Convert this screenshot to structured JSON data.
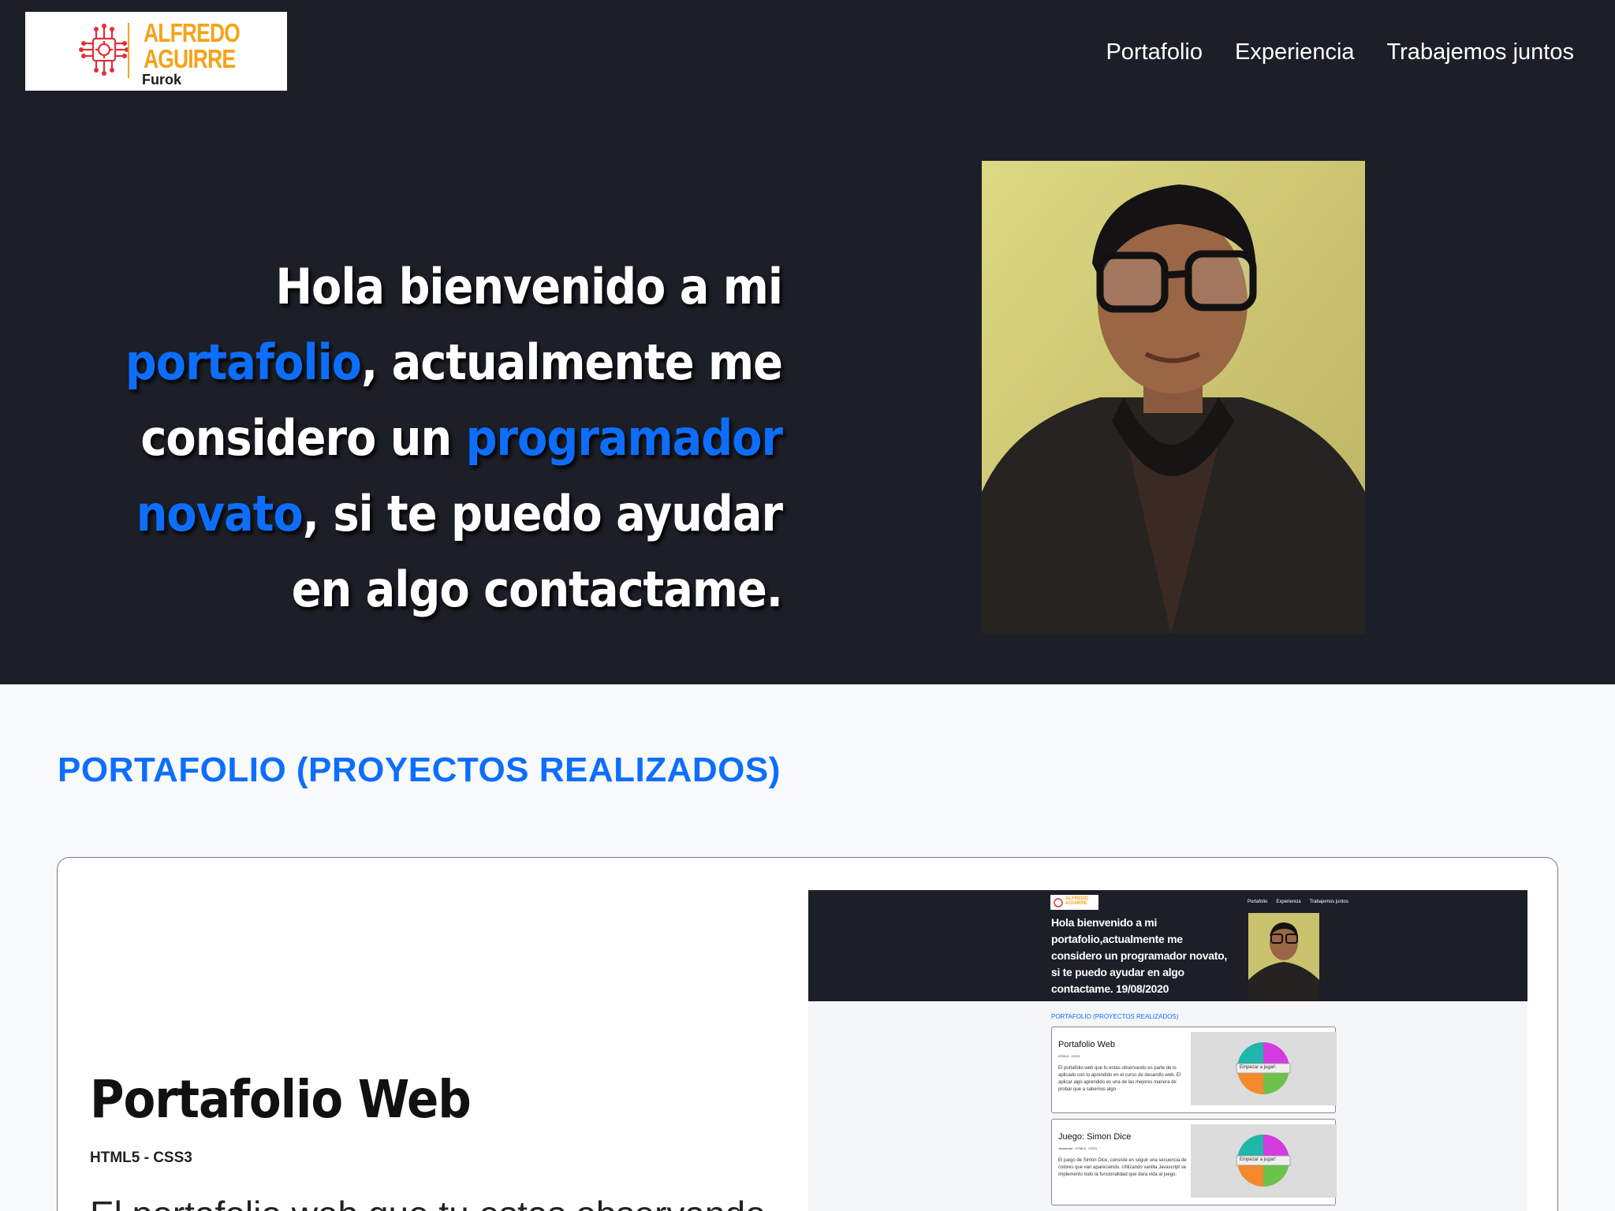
{
  "colors": {
    "header_bg": "#1c1f27",
    "accent": "#0d6efd",
    "logo_orange": "#f4a31a",
    "logo_red": "#e0303a",
    "page_bg": "#f8f9fb"
  },
  "logo": {
    "name_line1": "ALFREDO",
    "name_line2": "AGUIRRE",
    "sub": "Furok",
    "icon": "circuit-brain-icon"
  },
  "nav": [
    "Portafolio",
    "Experiencia",
    "Trabajemos juntos"
  ],
  "hero": {
    "part1": "Hola bienvenido a mi ",
    "accent1": "portafolio",
    "part2": ", actualmente me considero un ",
    "accent2": "programador novato",
    "part3": ", si te puedo ayudar en algo contactame."
  },
  "section_title": "PORTAFOLIO (PROYECTOS REALIZADOS)",
  "project": {
    "title": "Portafolio Web",
    "tags": "HTML5 - CSS3",
    "description": "El portafolio web que tu estas observando"
  },
  "preview": {
    "logo": "ALFREDO AGUIRRE",
    "nav": [
      "Portafolio",
      "Experiencia",
      "Trabajemos juntos"
    ],
    "hero": "Hola bienvenido a mi portafolio,actualmente me considero un programador novato, si te puedo ayudar en algo contactame. 19/08/2020",
    "section_title": "PORTAFOLIO (PROYECTOS REALIZADOS)",
    "cards": [
      {
        "title": "Portafolio Web",
        "tags": "HTML5 - CSS3",
        "desc": "El portafolio web que tu estas observando es parte de lo aplicado con lo aprendido en el curso de desarollo web. El aplicar algo aprendido es una de las mejores manera de probar que a sabemos algo.",
        "button": "Empezar a jugar!"
      },
      {
        "title": "Juego: Simon Dice",
        "tags": "Javascript - HTML5 - CSS3",
        "desc": "El juego de Simon Dice, consiste en seguir una secuencia de colores que van apareciendo. Utilizando vanilla Javascript se implemento todo la funcionalidad que dara vida al juego.",
        "button": "Empezar a jugar!"
      }
    ]
  }
}
